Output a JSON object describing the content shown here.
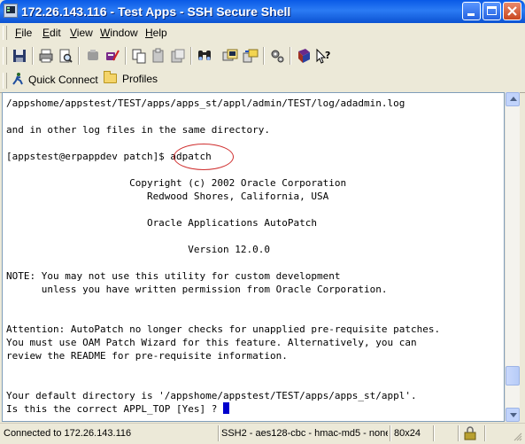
{
  "window": {
    "title": "172.26.143.116 - Test Apps - SSH Secure Shell"
  },
  "menu": {
    "items": [
      "File",
      "Edit",
      "View",
      "Window",
      "Help"
    ]
  },
  "toolbar": {
    "icons": [
      "save-icon",
      "print-icon",
      "print-preview-icon",
      "disconnect-icon",
      "connect-icon",
      "copy-icon",
      "paste-icon",
      "paste-all-icon",
      "find-icon",
      "new-terminal-icon",
      "file-transfer-icon",
      "settings-icon",
      "help-book-icon",
      "help-pointer-icon"
    ]
  },
  "quickbar": {
    "quick_connect": "Quick Connect",
    "profiles": "Profiles"
  },
  "terminal": {
    "lines": [
      "/appshome/appstest/TEST/apps/apps_st/appl/admin/TEST/log/adadmin.log",
      "",
      "and in other log files in the same directory.",
      "",
      "[appstest@erpappdev patch]$ adpatch",
      "",
      "                     Copyright (c) 2002 Oracle Corporation",
      "                        Redwood Shores, California, USA",
      "",
      "                        Oracle Applications AutoPatch",
      "",
      "                               Version 12.0.0",
      "",
      "NOTE: You may not use this utility for custom development",
      "      unless you have written permission from Oracle Corporation.",
      "",
      "",
      "Attention: AutoPatch no longer checks for unapplied pre-requisite patches.",
      "You must use OAM Patch Wizard for this feature. Alternatively, you can",
      "review the README for pre-requisite information.",
      "",
      "",
      "Your default directory is '/appshome/appstest/TEST/apps/apps_st/appl'.",
      "Is this the correct APPL_TOP [Yes] ? "
    ],
    "scroll_position": 0.92
  },
  "status": {
    "connection": "Connected to 172.26.143.116",
    "cipher": "SSH2 - aes128-cbc - hmac-md5 - none",
    "size": "80x24"
  }
}
